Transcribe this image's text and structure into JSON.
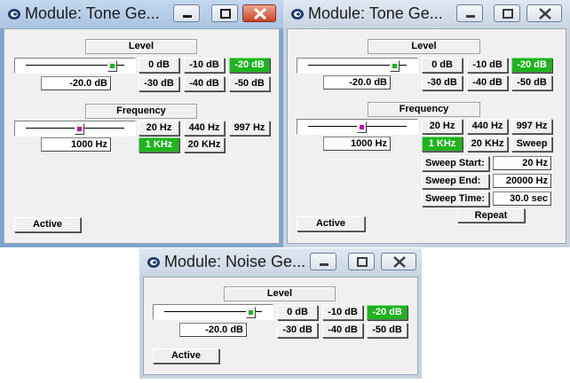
{
  "colors": {
    "selected_button": "#1eb41e",
    "level_thumb": "#1eb41e",
    "frequency_thumb": "#c000c0"
  },
  "windows": [
    {
      "title": "Module: Tone Ge...",
      "state": "active",
      "level": {
        "header": "Level",
        "value": "-20.0 dB",
        "buttons": [
          "0 dB",
          "-10 dB",
          "-20 dB",
          "-30 dB",
          "-40 dB",
          "-50 dB"
        ],
        "selected": "-20 dB"
      },
      "frequency": {
        "header": "Frequency",
        "value": "1000 Hz",
        "buttons": [
          "20 Hz",
          "440 Hz",
          "997 Hz",
          "1 KHz",
          "20 KHz"
        ],
        "selected": "1 KHz"
      },
      "active_label": "Active"
    },
    {
      "title": "Module: Tone Ge...",
      "state": "inactive",
      "level": {
        "header": "Level",
        "value": "-20.0 dB",
        "buttons": [
          "0 dB",
          "-10 dB",
          "-20 dB",
          "-30 dB",
          "-40 dB",
          "-50 dB"
        ],
        "selected": "-20 dB"
      },
      "frequency": {
        "header": "Frequency",
        "value": "1000 Hz",
        "buttons": [
          "20 Hz",
          "440 Hz",
          "997 Hz",
          "1 KHz",
          "20 KHz",
          "Sweep"
        ],
        "selected": "1 KHz"
      },
      "sweep": {
        "start_label": "Sweep Start:",
        "start_value": "20 Hz",
        "end_label": "Sweep End:",
        "end_value": "20000 Hz",
        "time_label": "Sweep Time:",
        "time_value": "30.0 sec",
        "repeat_label": "Repeat"
      },
      "active_label": "Active"
    },
    {
      "title": "Module: Noise Ge...",
      "state": "inactive",
      "level": {
        "header": "Level",
        "value": "-20.0 dB",
        "buttons": [
          "0 dB",
          "-10 dB",
          "-20 dB",
          "-30 dB",
          "-40 dB",
          "-50 dB"
        ],
        "selected": "-20 dB"
      },
      "active_label": "Active"
    }
  ],
  "title_controls": {
    "minimize_icon": "minimize-icon",
    "maximize_icon": "maximize-icon",
    "close_icon": "close-icon"
  }
}
